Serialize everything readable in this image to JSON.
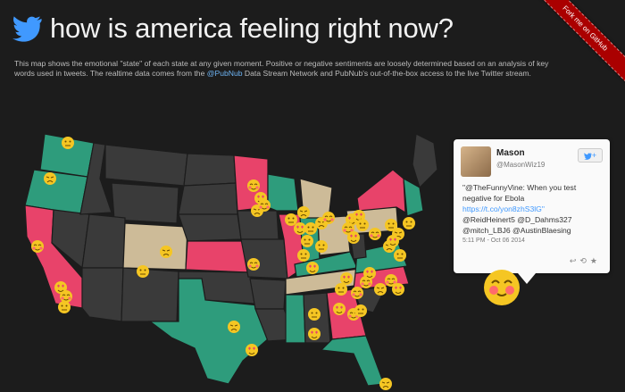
{
  "header": {
    "title": "how is america feeling right now?",
    "description_part1": "This map shows the emotional \"state\" of each state at any given moment. Positive or negative sentiments are loosely determined based on an analysis of key words used in tweets. The realtime data comes from the ",
    "pubnub_link": "@PubNub",
    "description_part2": " Data Stream Network and PubNub's out-of-the-box access to the live Twitter stream."
  },
  "ribbon": {
    "label": "Fork me on GitHub"
  },
  "colors": {
    "happy": "#e8436a",
    "sad": "#2e9c7c",
    "neutral": "#cdbb98",
    "none": "#3a3a3a",
    "background": "#1c1c1c",
    "twitter": "#4099ff"
  },
  "tweet_card": {
    "name": "Mason",
    "handle": "@MasonWiz19",
    "follow_label": "+",
    "text_line1": "\"@TheFunnyVine: When you test negative for Ebola",
    "link": "https://t.co/yon8zhS3lG\"",
    "text_line2": "@ReidHeinert5 @D_Dahms327 @mitch_LBJ6 @AustinBlaesing",
    "timestamp": "5:11 PM - Oct 06 2014"
  },
  "legend_icons": [
    "twitter-bird-icon",
    "happy-face-icon",
    "sad-face-icon",
    "neutral-face-icon",
    "love-face-icon"
  ]
}
